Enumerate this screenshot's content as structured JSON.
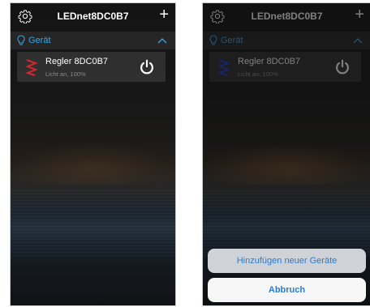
{
  "header": {
    "title": "LEDnet8DC0B7",
    "add_symbol": "+"
  },
  "section": {
    "label": "Gerät"
  },
  "device": {
    "name": "Regler 8DC0B7",
    "status": "Licht an, 100%",
    "icon_color_left": "#d9262c",
    "icon_color_right": "#1f3fd1"
  },
  "action_sheet": {
    "option_label": "Hinzufügen neuer Geräte",
    "cancel_label": "Abbruch"
  },
  "colors": {
    "accent": "#3aa7e6",
    "sheet_text": "#2a7bd6"
  }
}
